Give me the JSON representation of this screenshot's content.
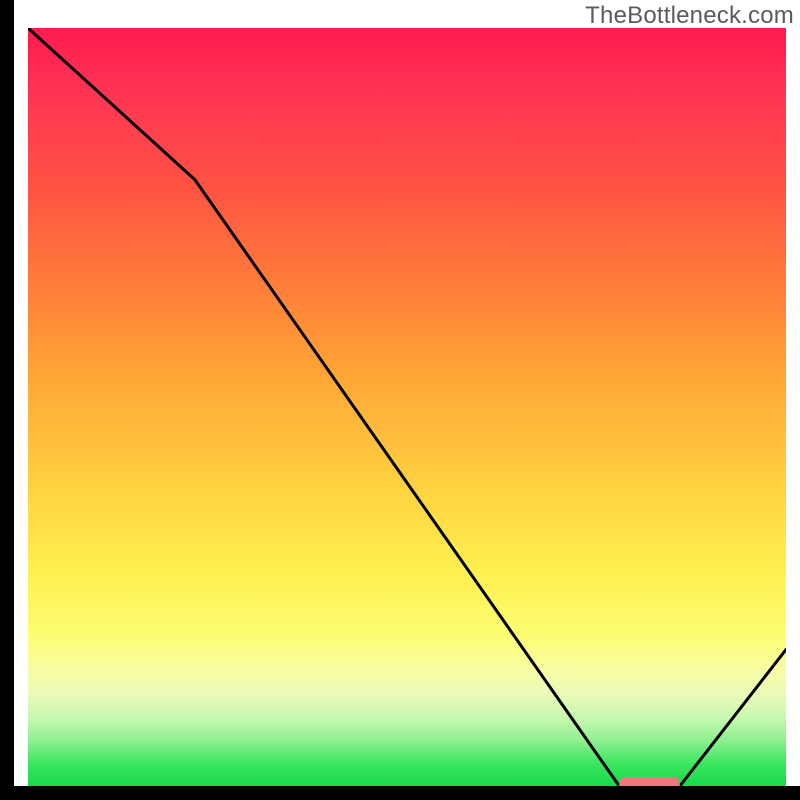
{
  "watermark": "TheBottleneck.com",
  "chart_data": {
    "type": "line",
    "title": "",
    "xlabel": "",
    "ylabel": "",
    "xlim": [
      0,
      100
    ],
    "ylim": [
      0,
      100
    ],
    "series": [
      {
        "name": "curve",
        "x": [
          0,
          22,
          78,
          86,
          100
        ],
        "values": [
          100,
          80,
          0,
          0,
          18
        ]
      }
    ],
    "marker": {
      "name": "bottleneck-range",
      "x_start": 78,
      "x_end": 86,
      "y": 0,
      "color": "#e77b7d"
    },
    "gradient_stops": [
      {
        "pos": 0.0,
        "color": "#ff1a4d"
      },
      {
        "pos": 0.2,
        "color": "#ff5044"
      },
      {
        "pos": 0.46,
        "color": "#ffa636"
      },
      {
        "pos": 0.72,
        "color": "#fff050"
      },
      {
        "pos": 0.88,
        "color": "#e8fbb8"
      },
      {
        "pos": 1.0,
        "color": "#18d94c"
      }
    ]
  }
}
